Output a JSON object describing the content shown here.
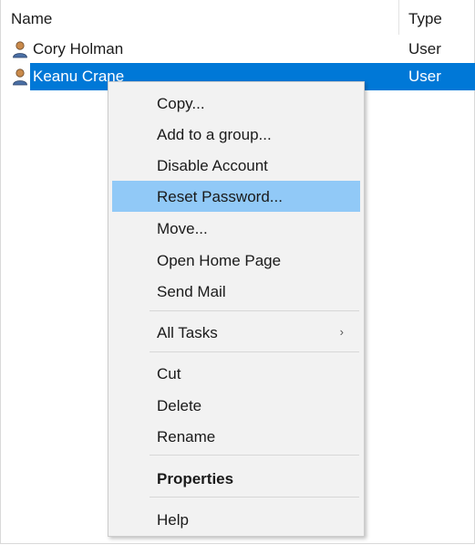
{
  "columns": {
    "name": "Name",
    "type": "Type"
  },
  "rows": [
    {
      "name": "Cory Holman",
      "type": "User",
      "icon": "user-icon",
      "selected": false
    },
    {
      "name": "Keanu Crane",
      "type": "User",
      "icon": "user-icon",
      "selected": true
    }
  ],
  "context_menu": {
    "items": [
      {
        "label": "Copy..."
      },
      {
        "label": "Add to a group..."
      },
      {
        "label": "Disable Account"
      },
      {
        "label": "Reset Password...",
        "highlighted": true
      },
      {
        "label": "Move..."
      },
      {
        "label": "Open Home Page"
      },
      {
        "label": "Send Mail"
      },
      {
        "label": "All Tasks",
        "submenu": true
      },
      {
        "label": "Cut"
      },
      {
        "label": "Delete"
      },
      {
        "label": "Rename"
      },
      {
        "label": "Properties",
        "bold": true
      },
      {
        "label": "Help"
      }
    ],
    "submenu_arrow": "›"
  },
  "colors": {
    "selection": "#0078d7",
    "menu_highlight": "#91c9f7",
    "menu_background": "#f2f2f2"
  }
}
